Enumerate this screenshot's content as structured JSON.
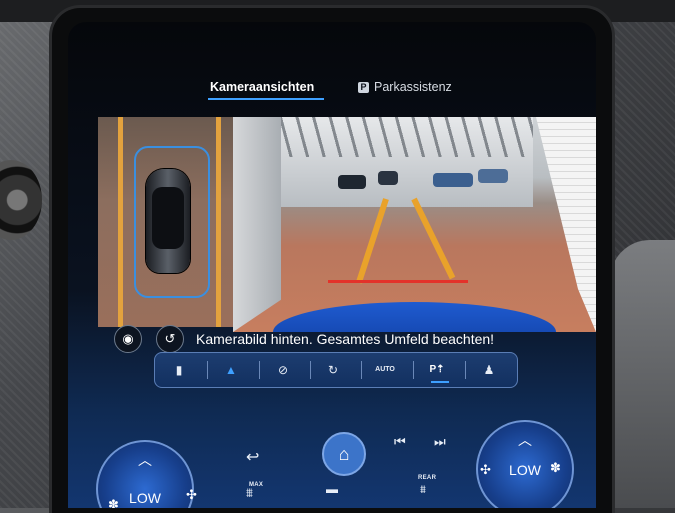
{
  "tabs": {
    "camera_views": "Kameraansichten",
    "park_icon_letter": "P",
    "park_assist": "Parkassistenz"
  },
  "message": "Kamerabild hinten. Gesamtes Umfeld beachten!",
  "view_bar": {
    "active": "P⇡",
    "auto_label": "AUTO",
    "items": [
      "rear-view",
      "top-view",
      "car-side-view",
      "car-front-view",
      "auto-view",
      "parking-view",
      "person-view"
    ]
  },
  "climate": {
    "left_temp": "LOW",
    "right_temp": "LOW",
    "max_label": "MAX",
    "rear_label": "REAR"
  },
  "colors": {
    "accent": "#3ea0ff",
    "guide_lines": "#e9a22b",
    "stop_line": "#e3322a"
  }
}
